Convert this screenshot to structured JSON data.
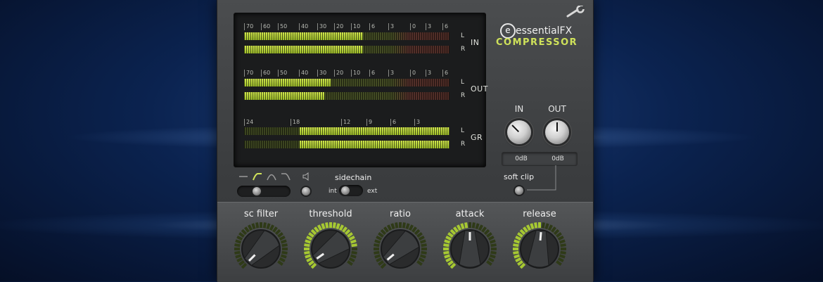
{
  "brand": {
    "logo_letter": "e",
    "name": "essentialFX",
    "product": "COMPRESSOR"
  },
  "meters": {
    "scale_db": [
      "70",
      "60",
      "50",
      "40",
      "30",
      "20",
      "10",
      "6",
      "3",
      "0",
      "3",
      "6"
    ],
    "gr_scale": [
      "24",
      "18",
      "12",
      "9",
      "6",
      "3"
    ],
    "groups": [
      {
        "label": "IN",
        "channels": [
          {
            "label": "L",
            "level": 0.58
          },
          {
            "label": "R",
            "level": 0.58
          }
        ]
      },
      {
        "label": "OUT",
        "channels": [
          {
            "label": "L",
            "level": 0.42
          },
          {
            "label": "R",
            "level": 0.39
          }
        ]
      },
      {
        "label": "GR",
        "channels": [
          {
            "label": "L",
            "level": 0.73
          },
          {
            "label": "R",
            "level": 0.73
          }
        ]
      }
    ]
  },
  "io": {
    "in": {
      "label": "IN",
      "value": "0dB",
      "angle_deg": -45
    },
    "out": {
      "label": "OUT",
      "value": "0dB",
      "angle_deg": 0
    }
  },
  "soft_clip": {
    "label": "soft clip"
  },
  "sidechain": {
    "label": "sidechain",
    "int_label": "int",
    "ext_label": "ext"
  },
  "controls": [
    {
      "label": "sc filter",
      "value": "",
      "angle_deg": -135,
      "ring": 0.0,
      "color": "#8fb52a"
    },
    {
      "label": "threshold",
      "value": "",
      "angle_deg": -125,
      "ring": 0.82,
      "color": "#8fb52a"
    },
    {
      "label": "ratio",
      "value": "",
      "angle_deg": -130,
      "ring": 0.0,
      "color": "#8fb52a"
    },
    {
      "label": "attack",
      "value": "",
      "angle_deg": 0,
      "ring": 0.5,
      "color": "#8fb52a"
    },
    {
      "label": "release",
      "value": "",
      "angle_deg": 5,
      "ring": 0.52,
      "color": "#8fb52a"
    }
  ],
  "colors": {
    "accent": "#cfe25a",
    "meter_green": "#c2db43",
    "meter_red_zone": "#4d2c26"
  }
}
